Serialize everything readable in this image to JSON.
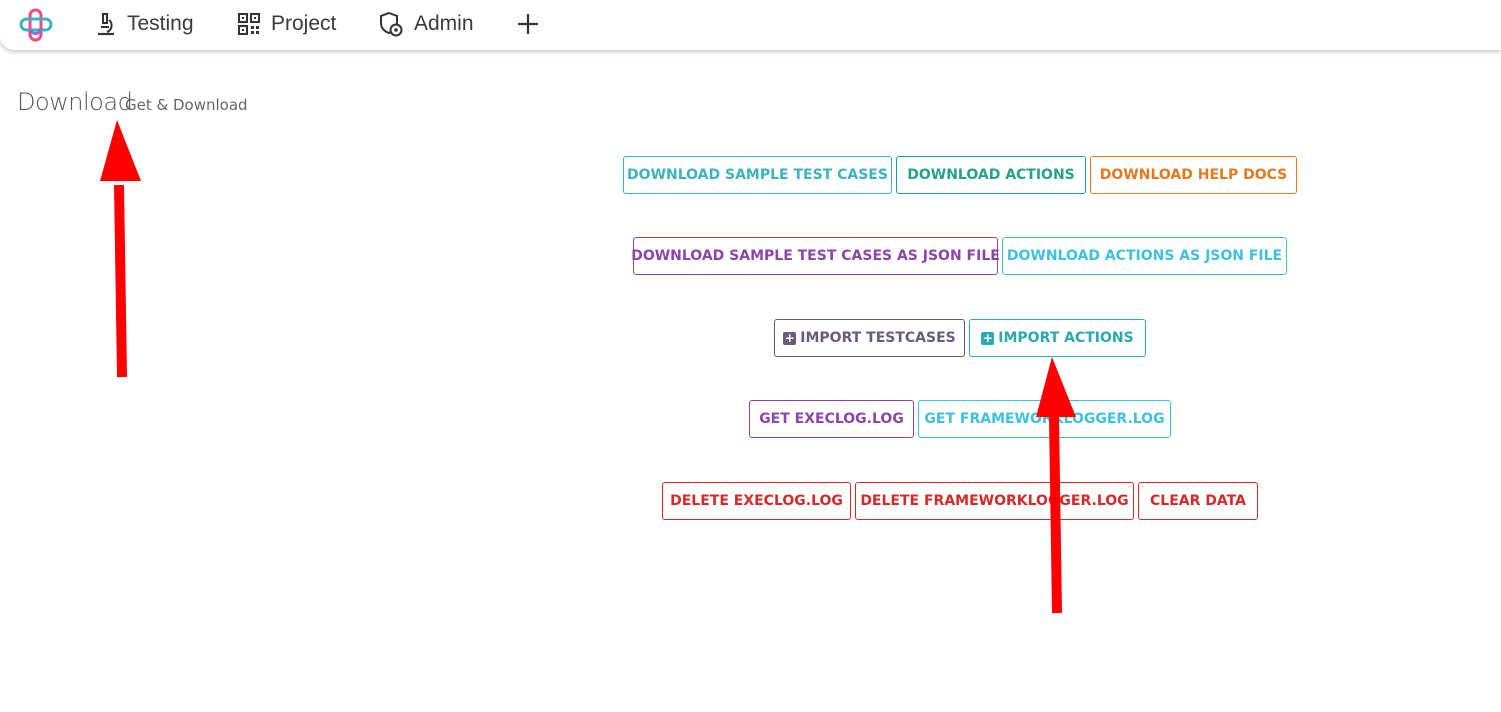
{
  "nav": {
    "items": [
      {
        "label": "Testing",
        "icon": "microscope-icon"
      },
      {
        "label": "Project",
        "icon": "qr-code-icon"
      },
      {
        "label": "Admin",
        "icon": "shield-settings-icon"
      }
    ],
    "add_icon": "plus-icon"
  },
  "page": {
    "title": "Download",
    "subtitle": "Get & Download"
  },
  "buttons": {
    "download_sample_test_cases": "DOWNLOAD SAMPLE TEST CASES",
    "download_actions": "DOWNLOAD ACTIONS",
    "download_help_docs": "DOWNLOAD HELP DOCS",
    "download_sample_json": "DOWNLOAD SAMPLE TEST CASES AS JSON FILE",
    "download_actions_json": "DOWNLOAD ACTIONS AS JSON FILE",
    "import_testcases": "IMPORT TESTCASES",
    "import_actions": "IMPORT ACTIONS",
    "get_execlog": "GET EXECLOG.LOG",
    "get_frameworklogger": "GET FRAMEWORKLOGGER.LOG",
    "delete_execlog": "DELETE EXECLOG.LOG",
    "delete_frameworklogger": "DELETE FRAMEWORKLOGGER.LOG",
    "clear_data": "CLEAR DATA"
  },
  "colors": {
    "teal": "#3bb3c0",
    "green": "#22a38a",
    "orange": "#e5791c",
    "purple": "#8e44ad",
    "cyan": "#3ec1e0",
    "slate": "#6b5b7b",
    "red": "#d42a2a",
    "annotation_arrow": "#ff0000"
  }
}
